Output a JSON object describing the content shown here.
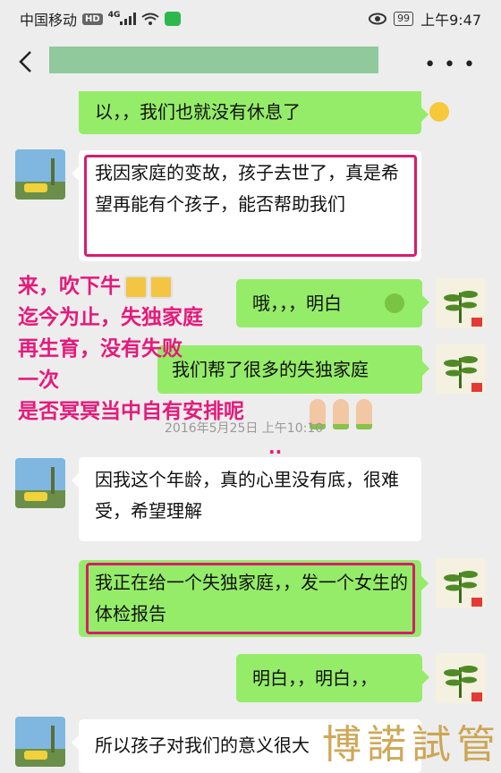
{
  "status_bar": {
    "carrier": "中国移动",
    "network_badge": "HD",
    "network_type": "4G",
    "battery": "99",
    "time": "上午9:47"
  },
  "header": {
    "title": "",
    "back_icon": "chevron-left-icon",
    "more_icon": "more-horizontal-icon"
  },
  "messages": [
    {
      "side": "right",
      "text": "以，，我们也就没有休息了",
      "emoji": "smiley"
    },
    {
      "side": "left",
      "text": "我因家庭的变故，孩子去世了，真是希望再能有个孩子，能否帮助我们",
      "highlighted": true
    },
    {
      "side": "right",
      "text": "哦，，，明白",
      "emoji": "frog"
    },
    {
      "side": "right",
      "text": "我们帮了很多的失独家庭"
    },
    {
      "side": "left",
      "text": "因我这个年龄，真的心里没有底，很难受，希望理解"
    },
    {
      "side": "right",
      "text": "我正在给一个失独家庭，，发一个女生的体检报告",
      "highlighted": true
    },
    {
      "side": "right",
      "text": "明白，，明白，，"
    },
    {
      "side": "left",
      "text": "所以孩子对我们的意义很大"
    }
  ],
  "timestamp": "2016年5月25日 上午10:10",
  "overlay_text": [
    "来，吹下牛",
    "迄今为止，失独家庭",
    "再生育，没有失败",
    "一次",
    "是否冥冥当中自有安排呢"
  ],
  "overlay_trailing": "..",
  "watermark": "博諾試管",
  "colors": {
    "green_bubble": "#95ec69",
    "highlight": "#d81b6f",
    "overlay": "#e6197a",
    "background": "#ededed"
  }
}
